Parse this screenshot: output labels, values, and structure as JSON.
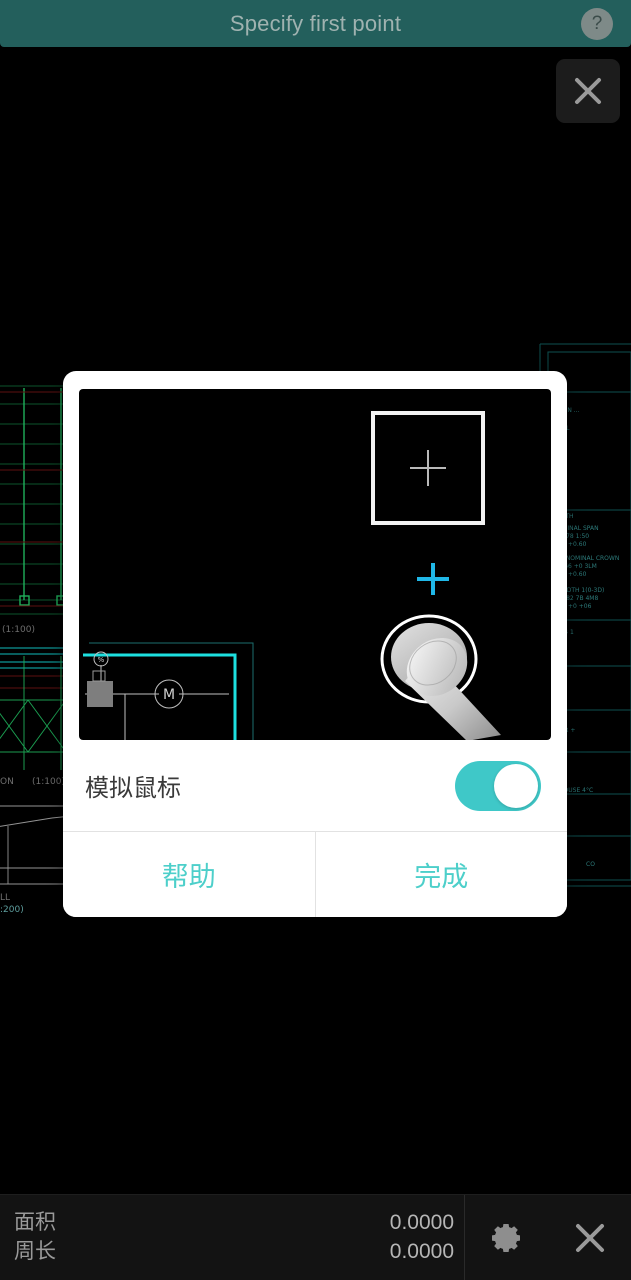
{
  "top_bar": {
    "title": "Specify first point",
    "help_label": "?",
    "background_color": "#235F5C",
    "title_color": "#9FB2B0"
  },
  "top_close": {
    "icon": "close-icon"
  },
  "dialog": {
    "illustration": {
      "magnifier_icon": "magnifier-preview-box",
      "crosshair_icon": "crosshair-icon",
      "cursor_icon": "cyan-crosshair-cursor-icon",
      "touch_icon": "finger-touch-icon",
      "cursor_color": "#20B8E8",
      "cad_line_color": "#1DE0E0"
    },
    "setting": {
      "label": "模拟鼠标",
      "toggle_state": "on",
      "toggle_color": "#3FC8C8"
    },
    "buttons": {
      "help": "帮助",
      "done": "完成",
      "color": "#4DCFCA"
    }
  },
  "bottom_bar": {
    "measures": [
      {
        "label": "面积",
        "value": "0.0000"
      },
      {
        "label": "周长",
        "value": "0.0000"
      }
    ],
    "actions": [
      {
        "name": "settings-button",
        "icon": "gear-icon"
      },
      {
        "name": "close-button",
        "icon": "close-icon"
      }
    ]
  }
}
